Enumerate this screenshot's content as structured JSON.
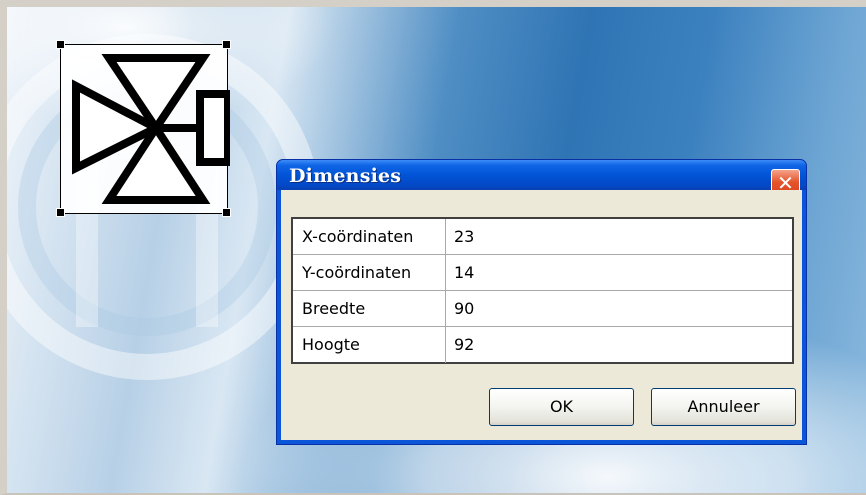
{
  "dialog": {
    "title": "Dimensies",
    "close_symbol": "✕",
    "fields": [
      {
        "label": "X-coördinaten",
        "value": "23"
      },
      {
        "label": "Y-coördinaten",
        "value": "14"
      },
      {
        "label": "Breedte",
        "value": "90"
      },
      {
        "label": "Hoogte",
        "value": "92"
      }
    ],
    "ok_label": "OK",
    "cancel_label": "Annuleer"
  },
  "canvas": {
    "selected_object_icon": "three-way-valve-icon"
  },
  "colors": {
    "title_bar": "#0254d6",
    "close_button": "#e4542b",
    "dialog_face": "#ece9d8"
  }
}
